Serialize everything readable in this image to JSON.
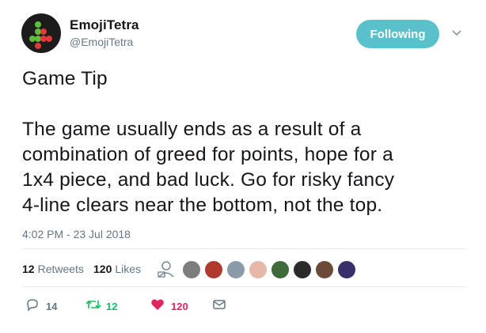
{
  "user": {
    "display_name": "EmojiTetra",
    "handle": "@EmojiTetra",
    "follow_label": "Following",
    "follow_color": "#58c1c9"
  },
  "tweet": {
    "text": "Game Tip\n\nThe game usually ends as a result of a\ncombination of greed for points, hope for a\n1x4 piece, and bad luck. Go for risky fancy\n4-line clears near the bottom, not the top.",
    "timestamp": "4:02 PM - 23 Jul 2018"
  },
  "stats": {
    "retweets_count": "12",
    "retweets_label": "Retweets",
    "likes_count": "120",
    "likes_label": "Likes"
  },
  "likers": [
    {
      "name": "liker-avatar-1",
      "color": "#7d7d7d"
    },
    {
      "name": "liker-avatar-2",
      "color": "#b03a2e"
    },
    {
      "name": "liker-avatar-3",
      "color": "#8a9aa8"
    },
    {
      "name": "liker-avatar-4",
      "color": "#e7b8a8"
    },
    {
      "name": "liker-avatar-5",
      "color": "#3f6b3a"
    },
    {
      "name": "liker-avatar-6",
      "color": "#2a2a2a"
    },
    {
      "name": "liker-avatar-7",
      "color": "#6b4a3a"
    },
    {
      "name": "liker-avatar-8",
      "color": "#3a2f6b"
    }
  ],
  "actions": {
    "reply_count": "14",
    "retweet_count": "12",
    "like_count": "120"
  },
  "colors": {
    "text": "#14171a",
    "muted": "#657786",
    "retweet_green": "#17bf63",
    "like_red": "#e0245e",
    "divider": "#e6ecf0"
  },
  "icons": [
    "avatar-logo",
    "chevron-down-icon",
    "reply-icon",
    "retweet-icon",
    "heart-icon",
    "dm-icon",
    "liker-outline-icon"
  ]
}
